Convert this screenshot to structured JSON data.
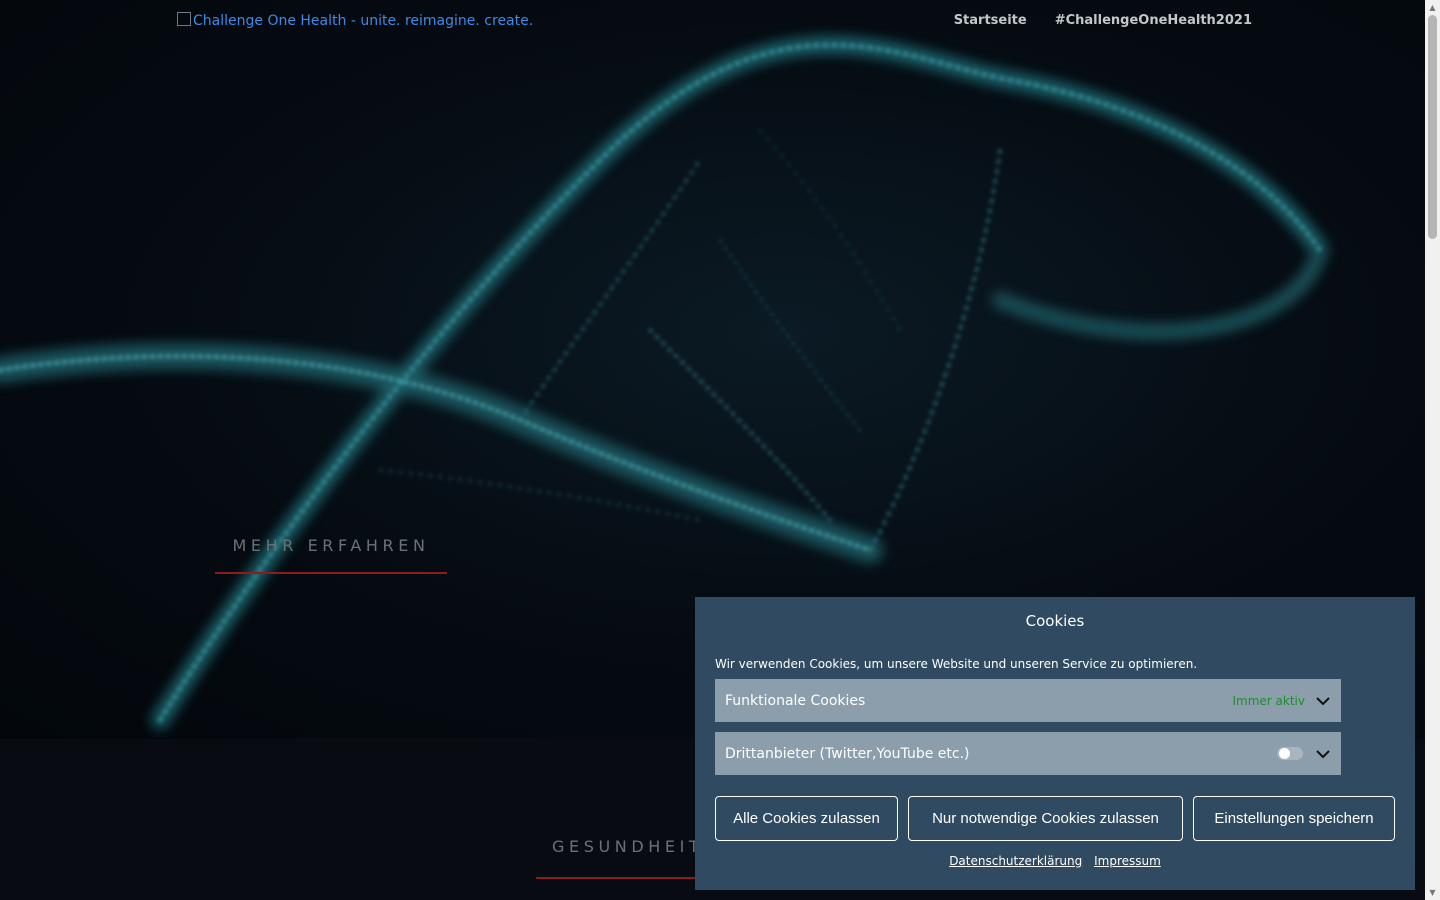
{
  "header": {
    "logo_alt": "Challenge One Health - unite. reimagine. create.",
    "nav": [
      "Startseite",
      "#ChallengeOneHealth2021"
    ]
  },
  "hero": {
    "more_button": "MEHR ERFAHREN"
  },
  "section": {
    "title": "GESUNDHEIT"
  },
  "cookie_banner": {
    "title": "Cookies",
    "message": "Wir verwenden Cookies, um unsere Website und unseren Service zu optimieren.",
    "categories": [
      {
        "label": "Funktionale Cookies",
        "status": "Immer aktiv"
      },
      {
        "label": "Drittanbieter (Twitter,YouTube etc.)",
        "enabled": false
      }
    ],
    "buttons": {
      "accept_all": "Alle Cookies zulassen",
      "accept_necessary": "Nur notwendige Cookies zulassen",
      "save": "Einstellungen speichern"
    },
    "links": {
      "privacy": "Datenschutzerklärung",
      "imprint": "Impressum"
    }
  },
  "colors": {
    "banner_bg": "#2f4a61",
    "category_bg": "#8c9eac",
    "active_green": "#1f8d2f",
    "accent_red": "#8a1d1d",
    "logo_link": "#3e8ae6"
  },
  "icons": [
    "broken-image-icon",
    "chevron-down-icon",
    "toggle-switch"
  ]
}
